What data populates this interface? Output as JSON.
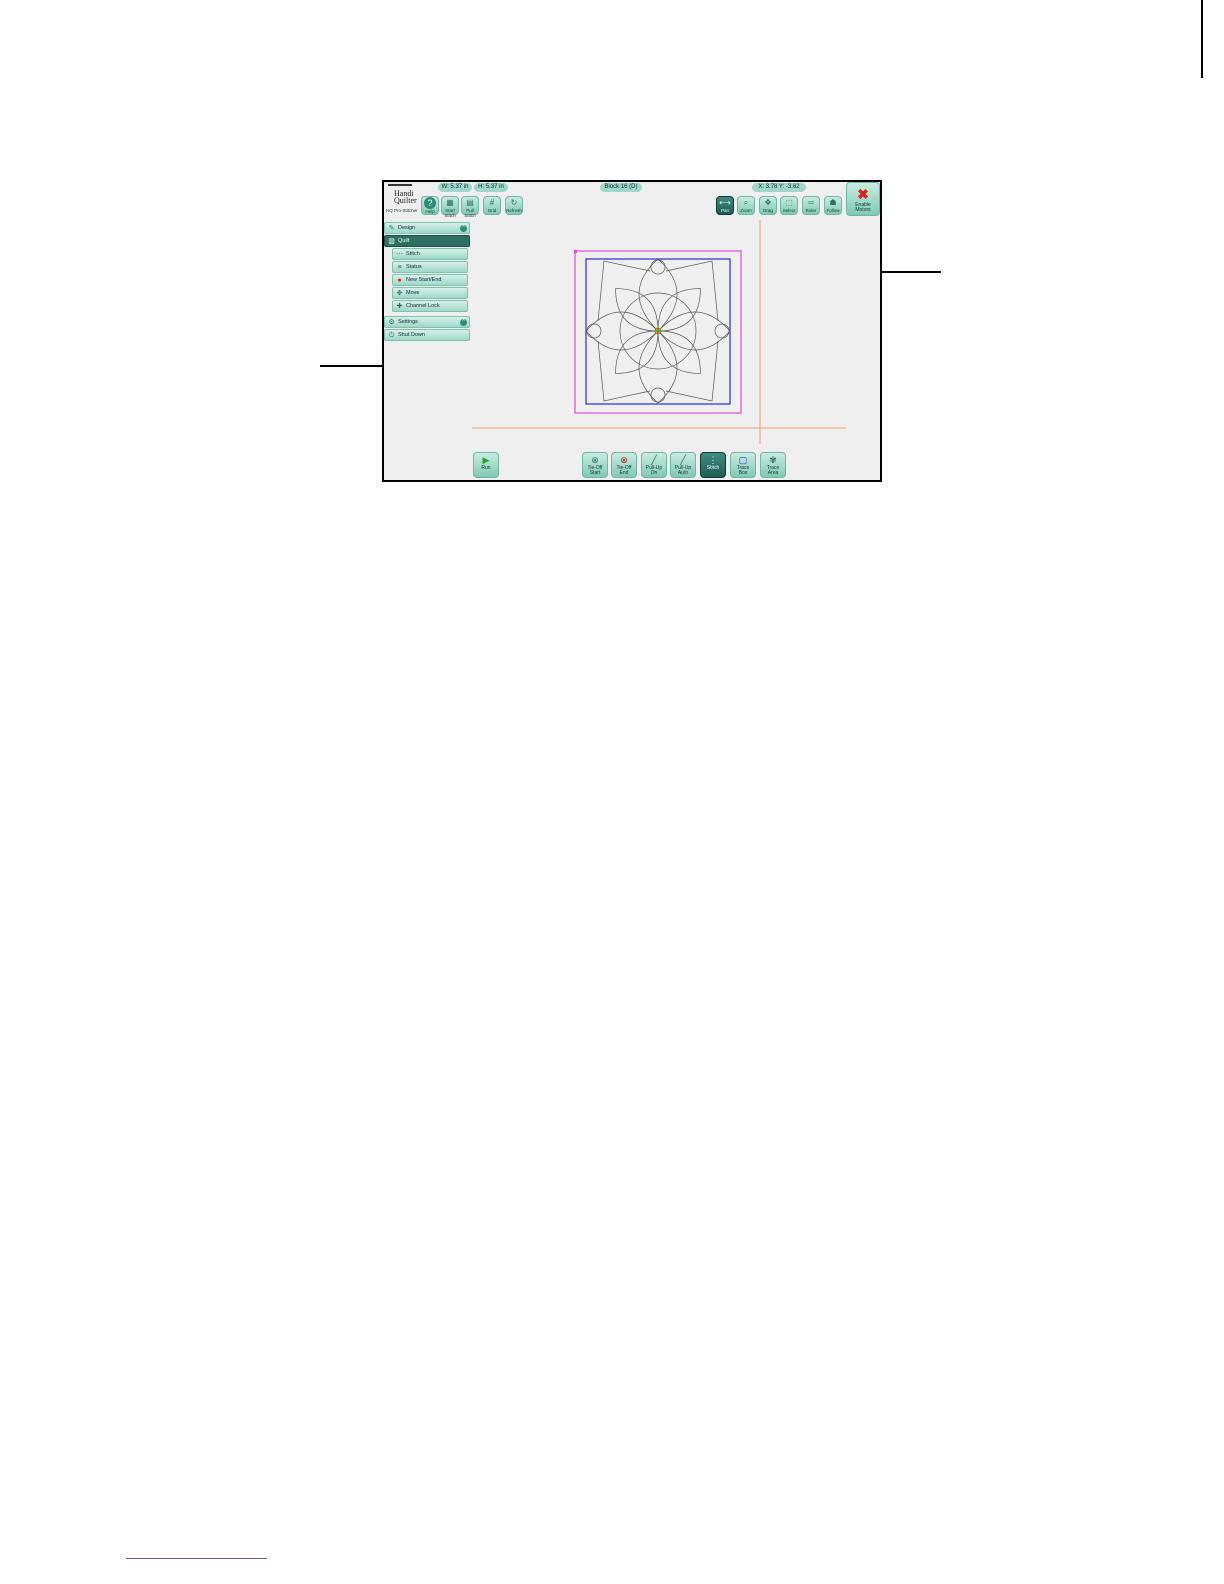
{
  "app": {
    "logo_line1": "Handi",
    "logo_line2": "Quilter",
    "logo_sub": "HQ Pro-Stitcher"
  },
  "header": {
    "width": "W: 5.37 in",
    "height": "H: 5.37 in",
    "block": "Block 16 (D)",
    "coords": "X: 3.78  Y: -3.62"
  },
  "toolbar_left": [
    {
      "label": "Help",
      "icon": "help-icon"
    },
    {
      "label": "Start Stitch",
      "icon": "start-icon"
    },
    {
      "label": "Pull Stitch",
      "icon": "pull-icon"
    },
    {
      "label": "Grid",
      "icon": "grid-icon"
    },
    {
      "label": "Refresh",
      "icon": "refresh-icon"
    }
  ],
  "toolbar_right": [
    {
      "label": "Pan",
      "icon": "pan-icon",
      "active": true
    },
    {
      "label": "Zoom",
      "icon": "zoom-icon"
    },
    {
      "label": "Drag",
      "icon": "drag-icon"
    },
    {
      "label": "Select",
      "icon": "select-icon"
    },
    {
      "label": "Ruler",
      "icon": "ruler-icon"
    },
    {
      "label": "Follow",
      "icon": "follow-icon"
    }
  ],
  "enable_motors": {
    "line1": "Enable",
    "line2": "Motors",
    "icon": "motor-off-icon"
  },
  "menu": [
    {
      "label": "Design",
      "icon": "design-icon",
      "chevron": true
    },
    {
      "label": "Quilt",
      "icon": "quilt-icon",
      "selected": true
    },
    {
      "label": "Stitch",
      "icon": "stitch-icon",
      "indent": true
    },
    {
      "label": "Status",
      "icon": "status-icon",
      "indent": true
    },
    {
      "label": "New Start/End",
      "icon": "start-end-icon",
      "indent": true
    },
    {
      "label": "Move",
      "icon": "move-icon",
      "indent": true
    },
    {
      "label": "Channel Lock",
      "icon": "channel-lock-icon",
      "indent": true
    },
    {
      "label": "Settings",
      "icon": "settings-icon",
      "chevron": true
    },
    {
      "label": "Shut Down",
      "icon": "power-icon"
    }
  ],
  "bottom_left": {
    "label": "Run",
    "icon": "play-icon"
  },
  "bottom_toolbar": [
    {
      "line1": "Tie-Off",
      "line2": "Start",
      "icon": "tie-off-start-icon"
    },
    {
      "line1": "Tie-Off",
      "line2": "End",
      "icon": "tie-off-end-icon"
    },
    {
      "line1": "Pull-Up",
      "line2": "On",
      "icon": "pull-up-on-icon"
    },
    {
      "line1": "Pull-Up",
      "line2": "Auto",
      "icon": "pull-up-auto-icon"
    },
    {
      "line1": "Stitch",
      "line2": "",
      "icon": "stitch-mode-icon",
      "active": true
    },
    {
      "line1": "Trace",
      "line2": "Box",
      "icon": "trace-box-icon"
    },
    {
      "line1": "Trace",
      "line2": "Area",
      "icon": "trace-area-icon"
    }
  ],
  "colors": {
    "accent": "#9fd8c8",
    "selected": "#2f6e62",
    "bounding_magenta": "#d84fd8",
    "bounding_blue": "#2b2bd0",
    "crosshair": "#f0a070"
  }
}
